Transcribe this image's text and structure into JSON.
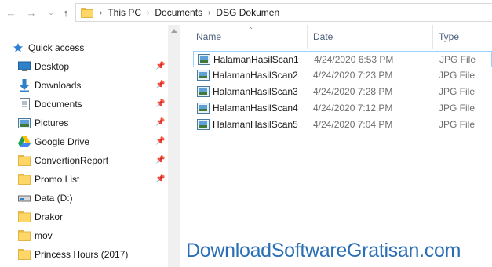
{
  "address_bar": {
    "breadcrumbs": [
      "This PC",
      "Documents",
      "DSG Dokumen"
    ]
  },
  "nav_pane": {
    "quick_access_label": "Quick access",
    "items": [
      {
        "label": "Desktop",
        "icon": "desktop-icon",
        "pinned": true
      },
      {
        "label": "Downloads",
        "icon": "downloads-icon",
        "pinned": true
      },
      {
        "label": "Documents",
        "icon": "documents-icon",
        "pinned": true
      },
      {
        "label": "Pictures",
        "icon": "pictures-icon",
        "pinned": true
      },
      {
        "label": "Google Drive",
        "icon": "google-drive-icon",
        "pinned": true
      },
      {
        "label": "ConvertionReport",
        "icon": "folder-icon",
        "pinned": true
      },
      {
        "label": "Promo List",
        "icon": "folder-icon",
        "pinned": true
      },
      {
        "label": "Data (D:)",
        "icon": "drive-icon",
        "pinned": false
      },
      {
        "label": "Drakor",
        "icon": "folder-icon",
        "pinned": false
      },
      {
        "label": "mov",
        "icon": "folder-icon",
        "pinned": false
      },
      {
        "label": "Princess Hours (2017)",
        "icon": "folder-icon",
        "pinned": false
      }
    ]
  },
  "file_list": {
    "columns": {
      "name": "Name",
      "date": "Date",
      "type": "Type"
    },
    "files": [
      {
        "name": "HalamanHasilScan1",
        "date": "4/24/2020 6:53 PM",
        "type": "JPG File"
      },
      {
        "name": "HalamanHasilScan2",
        "date": "4/24/2020 7:23 PM",
        "type": "JPG File"
      },
      {
        "name": "HalamanHasilScan3",
        "date": "4/24/2020 7:28 PM",
        "type": "JPG File"
      },
      {
        "name": "HalamanHasilScan4",
        "date": "4/24/2020 7:12 PM",
        "type": "JPG File"
      },
      {
        "name": "HalamanHasilScan5",
        "date": "4/24/2020 7:04 PM",
        "type": "JPG File"
      }
    ]
  },
  "watermark": "DownloadSoftwareGratisan.com"
}
